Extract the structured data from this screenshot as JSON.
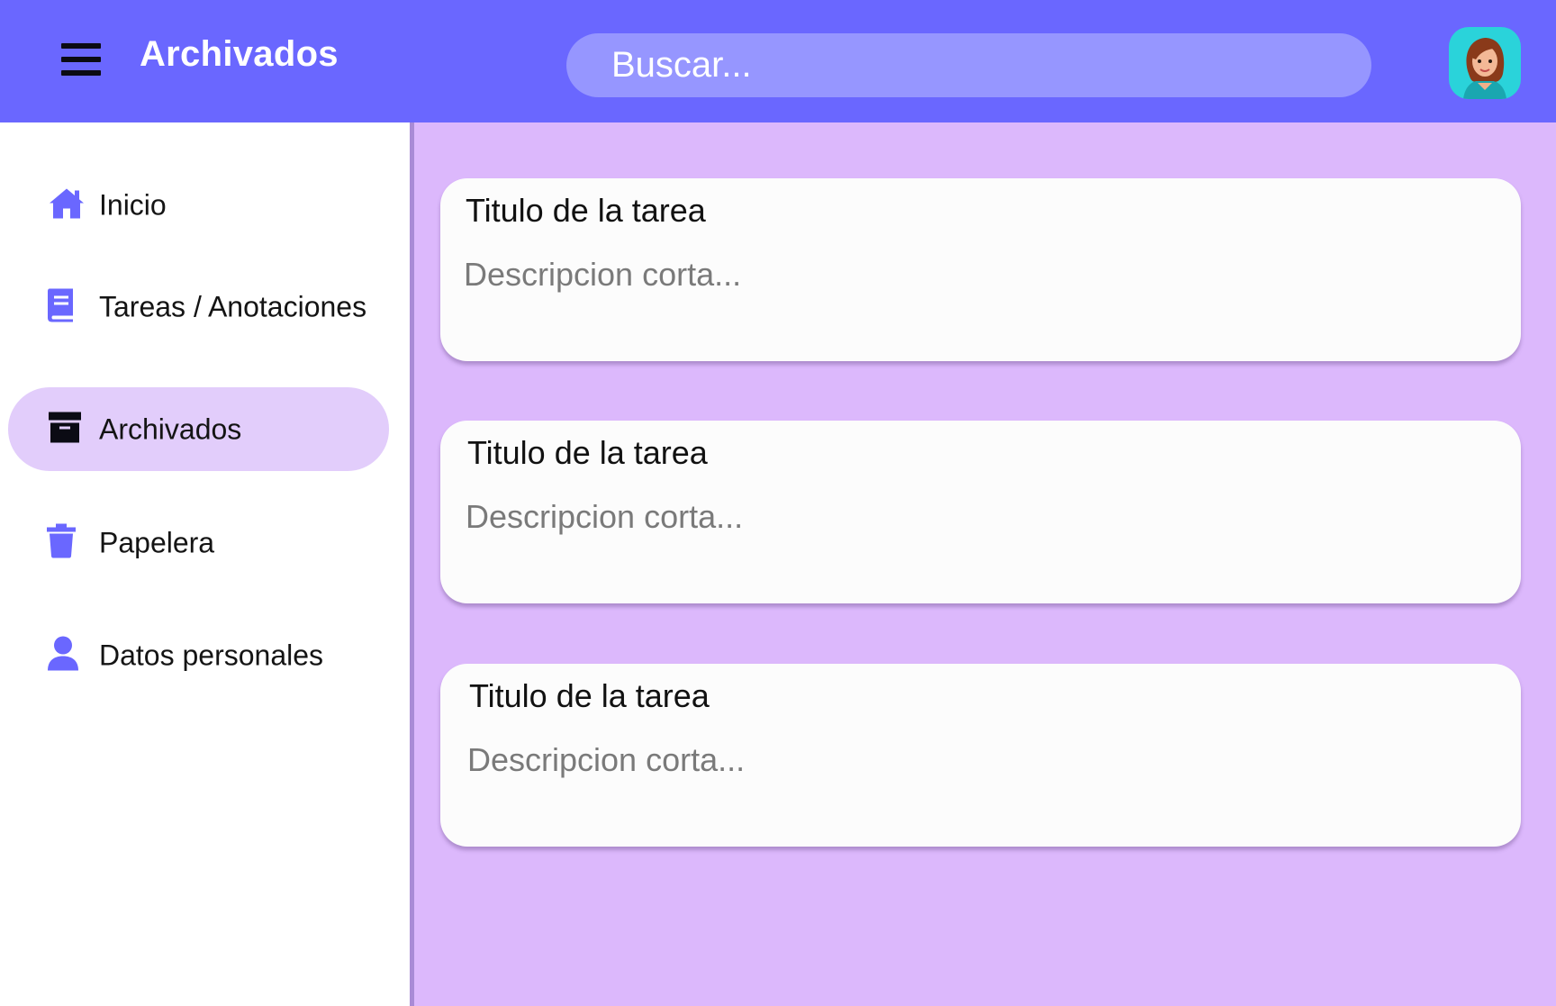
{
  "header": {
    "title": "Archivados",
    "search_placeholder": "Buscar...",
    "menu_icon": "hamburger-menu-icon",
    "avatar_icon": "user-avatar-icon"
  },
  "sidebar": {
    "items": [
      {
        "label": "Inicio",
        "icon": "home-icon",
        "active": false
      },
      {
        "label": "Tareas / Anotaciones",
        "icon": "book-icon",
        "active": false
      },
      {
        "label": "Archivados",
        "icon": "archive-box-icon",
        "active": true
      },
      {
        "label": "Papelera",
        "icon": "trash-icon",
        "active": false
      },
      {
        "label": "Datos personales",
        "icon": "person-icon",
        "active": false
      }
    ]
  },
  "main": {
    "tasks": [
      {
        "title": "Titulo de la tarea",
        "description": "Descripcion corta..."
      },
      {
        "title": "Titulo de la tarea",
        "description": "Descripcion corta..."
      },
      {
        "title": "Titulo de la tarea",
        "description": "Descripcion corta..."
      }
    ]
  },
  "colors": {
    "header": "#6a67ff",
    "search": "#9696ff",
    "content_bg": "#dcb8fc",
    "active_nav": "#e2cdfb",
    "icon_accent": "#6a67ff",
    "avatar_bg": "#2ad3da"
  }
}
